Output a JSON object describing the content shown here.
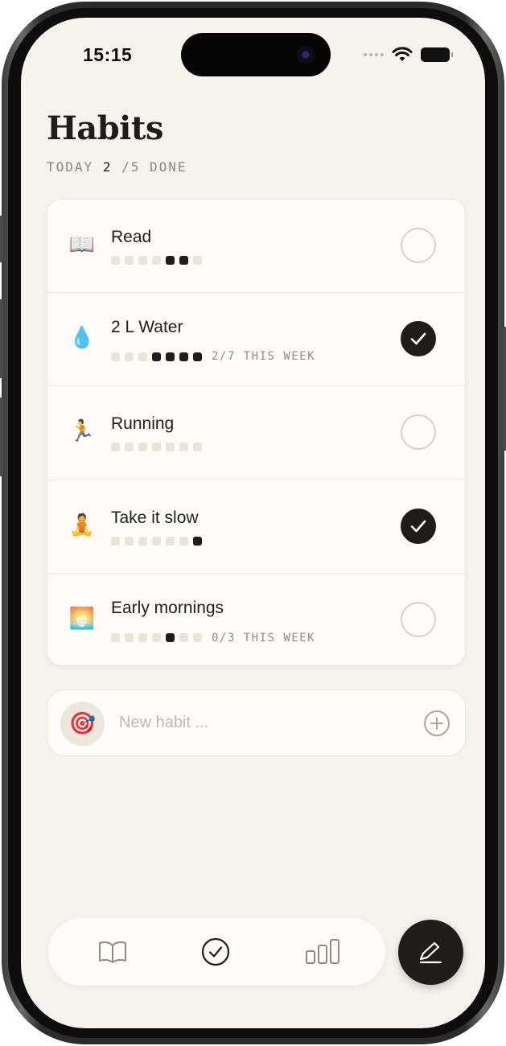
{
  "status_bar": {
    "time": "15:15"
  },
  "header": {
    "title": "Habits",
    "summary_prefix": "TODAY",
    "done_count": "2",
    "summary_suffix": "/5 DONE"
  },
  "habits": [
    {
      "emoji": "📖",
      "icon": "book-icon",
      "name": "Read",
      "week_dots": [
        0,
        0,
        0,
        0,
        1,
        1,
        0
      ],
      "week_label": "",
      "done": false
    },
    {
      "emoji": "💧",
      "icon": "water-drop-icon",
      "name": "2 L Water",
      "week_dots": [
        0,
        0,
        0,
        1,
        1,
        1,
        1
      ],
      "week_label": "2/7 THIS WEEK",
      "done": true
    },
    {
      "emoji": "🏃",
      "icon": "running-icon",
      "name": "Running",
      "week_dots": [
        0,
        0,
        0,
        0,
        0,
        0,
        0
      ],
      "week_label": "",
      "done": false
    },
    {
      "emoji": "🧘",
      "icon": "meditation-icon",
      "name": "Take it slow",
      "week_dots": [
        0,
        0,
        0,
        0,
        0,
        0,
        1
      ],
      "week_label": "",
      "done": true
    },
    {
      "emoji": "🌅",
      "icon": "sunrise-icon",
      "name": "Early mornings",
      "week_dots": [
        0,
        0,
        0,
        0,
        1,
        0,
        0
      ],
      "week_label": "0/3 THIS WEEK",
      "done": false
    }
  ],
  "new_habit": {
    "emoji": "🎯",
    "placeholder": "New habit ..."
  },
  "tabbar": {
    "tabs": [
      {
        "icon": "book-outline-icon"
      },
      {
        "icon": "check-circle-icon",
        "active": true
      },
      {
        "icon": "bar-chart-icon"
      }
    ]
  },
  "fab": {
    "icon": "pencil-icon"
  }
}
